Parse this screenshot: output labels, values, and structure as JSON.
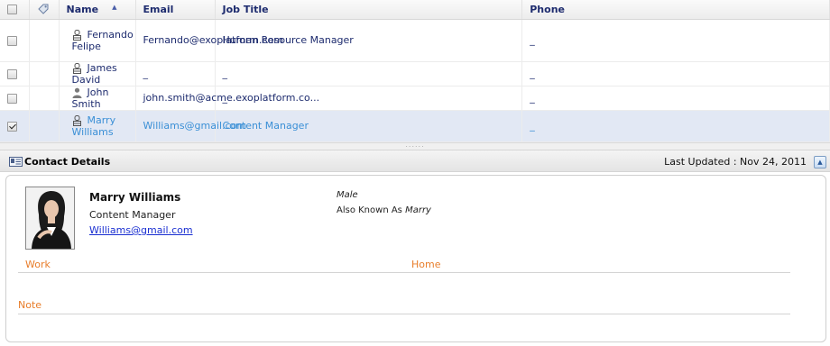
{
  "table": {
    "columns": {
      "name": "Name",
      "email": "Email",
      "job_title": "Job Title",
      "phone": "Phone"
    },
    "rows": [
      {
        "name": "Fernando Felipe",
        "email": "Fernando@exoplatform.com",
        "job_title": "Human Resource Manager",
        "phone": "_",
        "checked": false,
        "selected": false,
        "icon": "shared-contact-icon"
      },
      {
        "name": "James David",
        "email": "_",
        "job_title": "_",
        "phone": "_",
        "checked": false,
        "selected": false,
        "icon": "shared-contact-icon"
      },
      {
        "name": "John Smith",
        "email": "john.smith@acme.exoplatform.co...",
        "job_title": "_",
        "phone": "_",
        "checked": false,
        "selected": false,
        "icon": "person-icon"
      },
      {
        "name": "Marry Williams",
        "email": "Williams@gmail.com",
        "job_title": "Content Manager",
        "phone": "_",
        "checked": true,
        "selected": true,
        "icon": "shared-contact-icon"
      }
    ]
  },
  "details_bar": {
    "title": "Contact Details",
    "last_updated": "Last Updated : Nov 24, 2011"
  },
  "contact": {
    "name": "Marry Williams",
    "title": "Content Manager",
    "email": "Williams@gmail.com",
    "gender": "Male",
    "aka_label": "Also Known As",
    "aka_value": "Marry",
    "work_label": "Work",
    "home_label": "Home",
    "note_label": "Note"
  },
  "colors": {
    "header_text": "#1d2b6e",
    "selected_row_bg": "#e2e8f4",
    "selected_row_text": "#3a8fd6",
    "section_label": "#e87d2a",
    "link": "#1a2fd1"
  }
}
